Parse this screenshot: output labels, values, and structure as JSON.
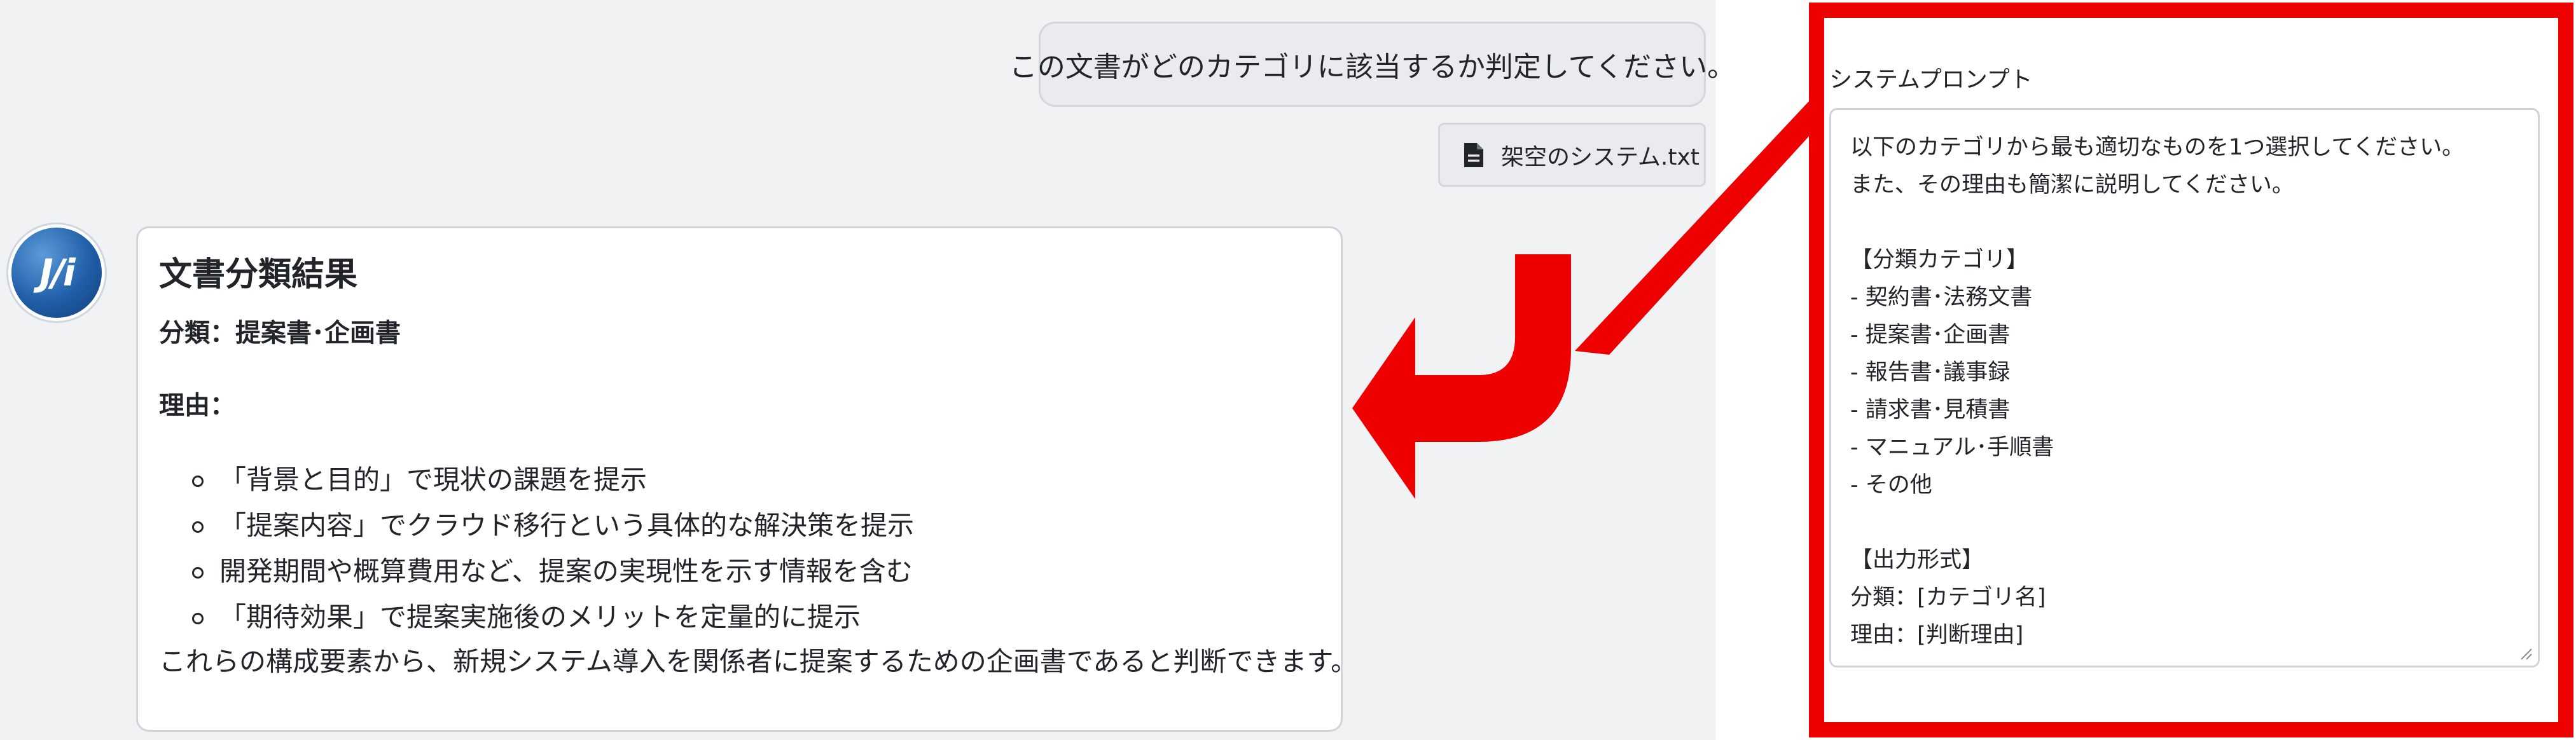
{
  "chat": {
    "user_message": "この文書がどのカテゴリに該当するか判定してください。",
    "attachment": {
      "icon": "file-icon",
      "filename": "架空のシステム.txt"
    },
    "assistant": {
      "avatar_text": "J/i",
      "title": "文書分類結果",
      "category_line": "分類：提案書･企画書",
      "reason_label": "理由：",
      "reasons": [
        "「背景と目的」で現状の課題を提示",
        "「提案内容」でクラウド移行という具体的な解決策を提示",
        "開発期間や概算費用など、提案の実現性を示す情報を含む",
        "「期待効果」で提案実施後のメリットを定量的に提示"
      ],
      "conclusion": "これらの構成要素から、新規システム導入を関係者に提案するための企画書であると判断できます。"
    }
  },
  "system_prompt": {
    "label": "システムプロンプト",
    "lines": [
      "以下のカテゴリから最も適切なものを1つ選択してください。",
      "また、その理由も簡潔に説明してください。",
      "",
      "【分類カテゴリ】",
      "- 契約書･法務文書",
      "- 提案書･企画書",
      "- 報告書･議事録",
      "- 請求書･見積書",
      "- マニュアル･手順書",
      "- その他",
      "",
      "【出力形式】",
      "分類：[カテゴリ名]",
      "理由：[判断理由]"
    ]
  },
  "colors": {
    "highlight_red": "#ee0000",
    "chat_background": "#f1f2f4",
    "avatar_blue": "#1f5ea8"
  }
}
